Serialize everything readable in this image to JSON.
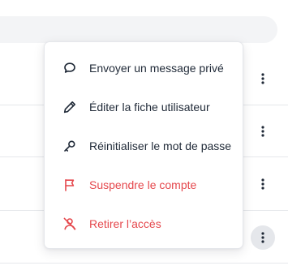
{
  "menu": {
    "items": [
      {
        "label": "Envoyer un message privé",
        "icon": "chat-bubble-icon",
        "tone": "default"
      },
      {
        "label": "Éditer la fiche utilisateur",
        "icon": "pencil-icon",
        "tone": "default"
      },
      {
        "label": "Réinitialiser le mot de passe",
        "icon": "key-icon",
        "tone": "default"
      },
      {
        "label": "Suspendre le compte",
        "icon": "flag-icon",
        "tone": "danger"
      },
      {
        "label": "Retirer l’accès",
        "icon": "user-off-icon",
        "tone": "danger"
      }
    ]
  },
  "colors": {
    "text": "#1f2937",
    "danger": "#e5484d",
    "divider": "#e5e7eb",
    "search_bg": "#f3f4f6",
    "active_button_bg": "#e5e7eb"
  }
}
